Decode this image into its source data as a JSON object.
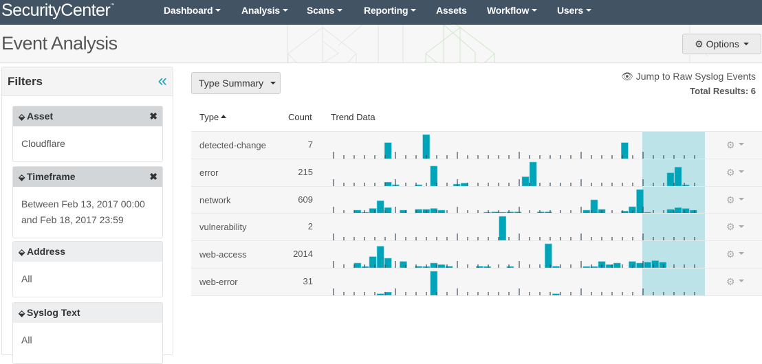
{
  "app": {
    "brand": "SecurityCenter",
    "brand_mark": "™"
  },
  "nav": {
    "items": [
      {
        "label": "Dashboard",
        "has_menu": true
      },
      {
        "label": "Analysis",
        "has_menu": true
      },
      {
        "label": "Scans",
        "has_menu": true
      },
      {
        "label": "Reporting",
        "has_menu": true
      },
      {
        "label": "Assets",
        "has_menu": false
      },
      {
        "label": "Workflow",
        "has_menu": true
      },
      {
        "label": "Users",
        "has_menu": true
      }
    ]
  },
  "page": {
    "title": "Event Analysis",
    "options_label": "Options",
    "options_icon": "gear-icon"
  },
  "sidebar": {
    "title": "Filters",
    "collapse_icon": "double-chevron-left-icon",
    "filters": [
      {
        "label": "Asset",
        "value": "Cloudflare",
        "removable": true
      },
      {
        "label": "Timeframe",
        "value": "Between Feb 13, 2017 00:00 and Feb 18, 2017 23:59",
        "removable": true
      },
      {
        "label": "Address",
        "value": "All",
        "removable": false
      },
      {
        "label": "Syslog Text",
        "value": "All",
        "removable": false
      }
    ]
  },
  "main": {
    "view_select": "Type Summary",
    "jump_link": "Jump to Raw Syslog Events",
    "total_results": "Total Results: 6",
    "columns": {
      "type": "Type",
      "count": "Count",
      "trend": "Trend Data"
    },
    "sort": {
      "column": "type",
      "direction": "ascending"
    },
    "colors": {
      "bar": "#00a4b8",
      "highlight": "#bce3e7",
      "tick": "#3b4d5e"
    },
    "trend_bins": 48,
    "highlight_bins": [
      41,
      48
    ],
    "rows": [
      {
        "type": "detected-change",
        "count": "7",
        "trend": [
          0,
          0,
          0,
          0,
          0,
          0,
          0,
          2,
          0,
          0,
          0,
          0,
          3,
          0,
          0,
          0,
          0,
          0,
          0,
          0,
          0,
          0,
          0,
          0,
          0,
          0,
          0,
          0,
          0,
          0,
          0,
          0,
          0,
          0,
          0,
          0,
          0,
          0,
          2,
          0,
          0,
          0,
          0,
          0,
          0,
          0,
          0,
          0
        ]
      },
      {
        "type": "error",
        "count": "215",
        "trend": [
          0,
          0,
          0,
          0,
          0,
          0,
          0,
          12,
          3,
          0,
          0,
          1,
          0,
          60,
          0,
          0,
          6,
          9,
          0,
          0,
          0,
          0,
          0,
          0,
          0,
          28,
          72,
          0,
          0,
          0,
          0,
          0,
          0,
          0,
          0,
          0,
          0,
          0,
          0,
          0,
          0,
          0,
          0,
          0,
          40,
          57,
          2,
          0
        ]
      },
      {
        "type": "network",
        "count": "609",
        "trend": [
          0,
          0,
          0,
          4,
          1,
          6,
          15,
          7,
          0,
          4,
          0,
          5,
          5,
          6,
          4,
          0,
          0,
          0,
          0,
          0,
          1,
          2,
          1,
          2,
          2,
          0,
          0,
          2,
          2,
          0,
          0,
          0,
          0,
          4,
          16,
          5,
          0,
          0,
          3,
          8,
          28,
          1,
          0,
          0,
          5,
          7,
          6,
          4
        ]
      },
      {
        "type": "vulnerability",
        "count": "2",
        "trend": [
          0,
          0,
          0,
          0,
          0,
          0,
          0,
          0,
          0,
          0,
          0,
          0,
          0,
          0,
          0,
          0,
          0,
          0,
          0,
          0,
          0,
          0,
          1,
          0,
          0,
          0,
          0,
          0,
          0,
          0,
          0,
          0,
          0,
          0,
          0,
          0,
          0,
          0,
          0,
          0,
          0,
          0,
          0,
          0,
          0,
          0,
          0,
          0
        ]
      },
      {
        "type": "web-access",
        "count": "2014",
        "trend": [
          0,
          0,
          0,
          30,
          5,
          70,
          135,
          60,
          0,
          40,
          0,
          10,
          5,
          30,
          20,
          10,
          0,
          0,
          0,
          10,
          5,
          0,
          0,
          5,
          0,
          0,
          0,
          0,
          150,
          10,
          0,
          0,
          0,
          5,
          5,
          40,
          20,
          30,
          0,
          40,
          30,
          35,
          45,
          35,
          0,
          0,
          0,
          0
        ]
      },
      {
        "type": "web-error",
        "count": "31",
        "trend": [
          0,
          0,
          0,
          0,
          0,
          0,
          1,
          2,
          0,
          0,
          0,
          0,
          0,
          15,
          0,
          0,
          0,
          0,
          0,
          0,
          0,
          0,
          0,
          0,
          0,
          0,
          0,
          0,
          0,
          1,
          0,
          0,
          0,
          0,
          0,
          0,
          0,
          0,
          0,
          0,
          0,
          0,
          0,
          0,
          0,
          0,
          0,
          0
        ]
      }
    ],
    "row_action_icon": "gear-icon"
  }
}
